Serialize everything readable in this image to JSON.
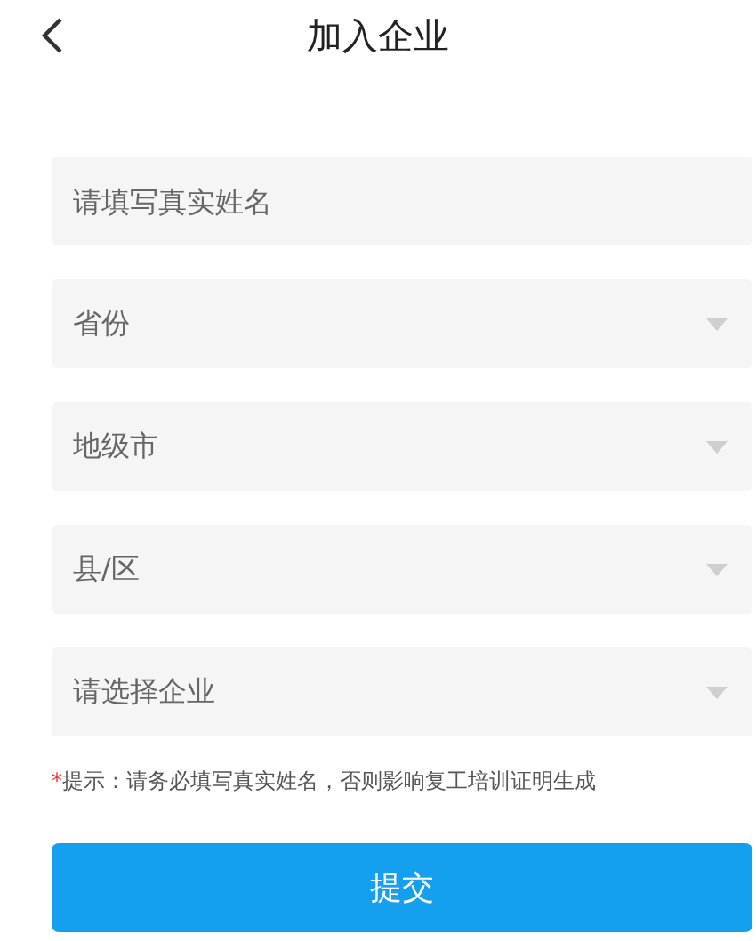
{
  "header": {
    "title": "加入企业"
  },
  "fields": [
    {
      "kind": "input",
      "placeholder": "请填写真实姓名"
    },
    {
      "kind": "select",
      "placeholder": "省份"
    },
    {
      "kind": "select",
      "placeholder": "地级市"
    },
    {
      "kind": "select",
      "placeholder": "县/区"
    },
    {
      "kind": "select",
      "placeholder": "请选择企业"
    }
  ],
  "hint": {
    "mark": "*",
    "text": "提示：请务必填写真实姓名，否则影响复工培训证明生成"
  },
  "submit": "提交"
}
